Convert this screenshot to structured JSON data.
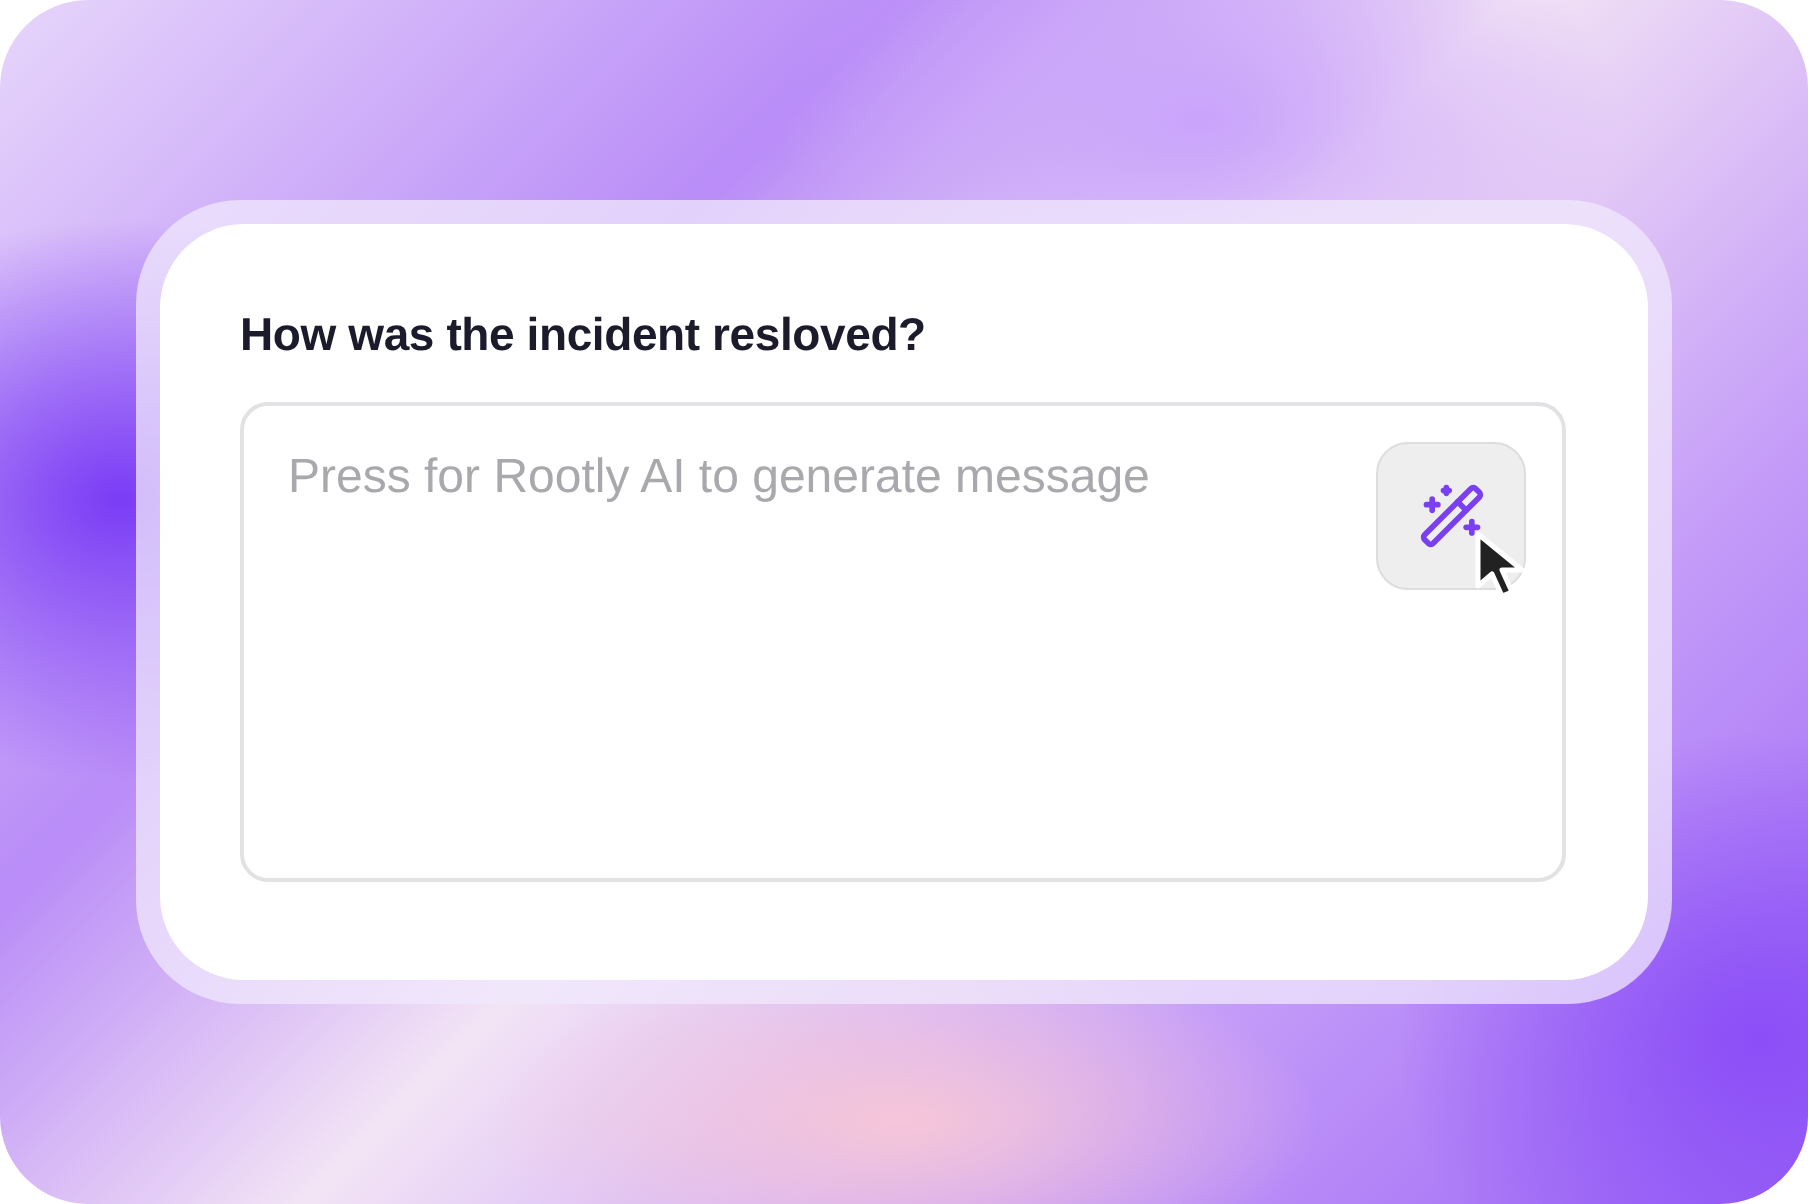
{
  "question": {
    "label": "How was the incident resloved?"
  },
  "message_field": {
    "placeholder": "Press for Rootly AI to generate message"
  }
}
